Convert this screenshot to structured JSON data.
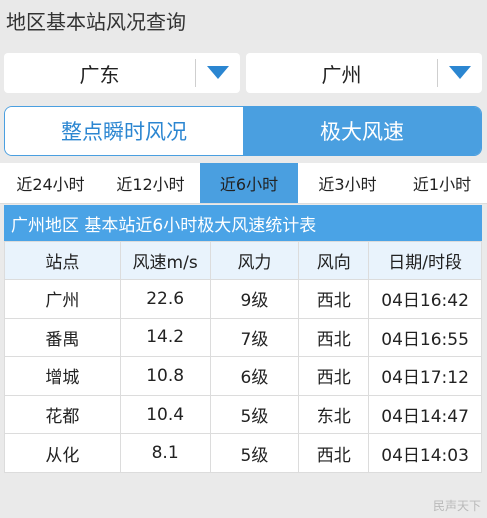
{
  "header": {
    "title": "地区基本站风况查询"
  },
  "selectors": {
    "province": "广东",
    "city": "广州"
  },
  "mode_toggle": {
    "options": [
      "整点瞬时风况",
      "极大风速"
    ],
    "selected": "极大风速"
  },
  "time_tabs": {
    "items": [
      "近24小时",
      "近12小时",
      "近6小时",
      "近3小时",
      "近1小时"
    ],
    "selected": "近6小时"
  },
  "table": {
    "title": "广州地区 基本站近6小时极大风速统计表",
    "headers": [
      "站点",
      "风速m/s",
      "风力",
      "风向",
      "日期/时段"
    ],
    "rows": [
      [
        "广州",
        "22.6",
        "9级",
        "西北",
        "04日16:42"
      ],
      [
        "番禺",
        "14.2",
        "7级",
        "西北",
        "04日16:55"
      ],
      [
        "增城",
        "10.8",
        "6级",
        "西北",
        "04日17:12"
      ],
      [
        "花都",
        "10.4",
        "5级",
        "东北",
        "04日14:47"
      ],
      [
        "从化",
        "8.1",
        "5级",
        "西北",
        "04日14:03"
      ]
    ]
  },
  "watermark": "民声天下",
  "colors": {
    "accent": "#4a9fe0",
    "header_bg": "#4aa3e6",
    "page_bg": "#eaeaea"
  }
}
